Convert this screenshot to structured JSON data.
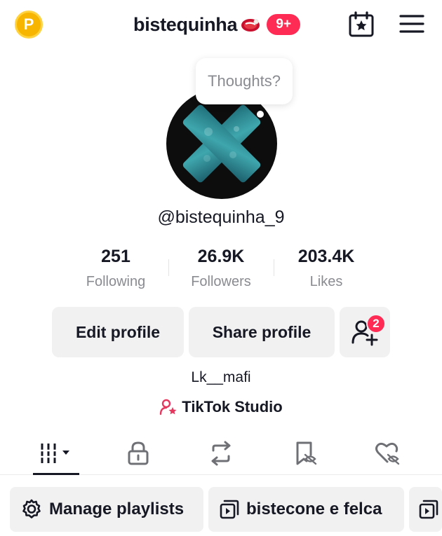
{
  "header": {
    "coin_letter": "P",
    "title": "bistequinha",
    "notif_count": "9+"
  },
  "profile": {
    "thought_placeholder": "Thoughts?",
    "handle": "@bistequinha_9",
    "bio": "Lk__mafi",
    "studio_label": "TikTok Studio"
  },
  "stats": [
    {
      "value": "251",
      "label": "Following"
    },
    {
      "value": "26.9K",
      "label": "Followers"
    },
    {
      "value": "203.4K",
      "label": "Likes"
    }
  ],
  "buttons": {
    "edit": "Edit profile",
    "share": "Share profile",
    "add_friends_count": "2"
  },
  "tabs": [
    {
      "name": "videos",
      "icon": "grid-dropdown-icon",
      "active": true
    },
    {
      "name": "private",
      "icon": "lock-icon",
      "active": false
    },
    {
      "name": "reposts",
      "icon": "repost-icon",
      "active": false
    },
    {
      "name": "favorites",
      "icon": "bookmark-hidden-icon",
      "active": false
    },
    {
      "name": "liked",
      "icon": "heart-hidden-icon",
      "active": false
    }
  ],
  "playlists": [
    {
      "label": "Manage playlists",
      "icon": "gear-icon"
    },
    {
      "label": "bistecone e felca",
      "icon": "playlist-icon"
    },
    {
      "label": "",
      "icon": "playlist-icon"
    }
  ],
  "colors": {
    "accent": "#fe2c55",
    "coin": "#f7b500",
    "muted": "#8a8b91",
    "button_bg": "#f1f1f2"
  }
}
